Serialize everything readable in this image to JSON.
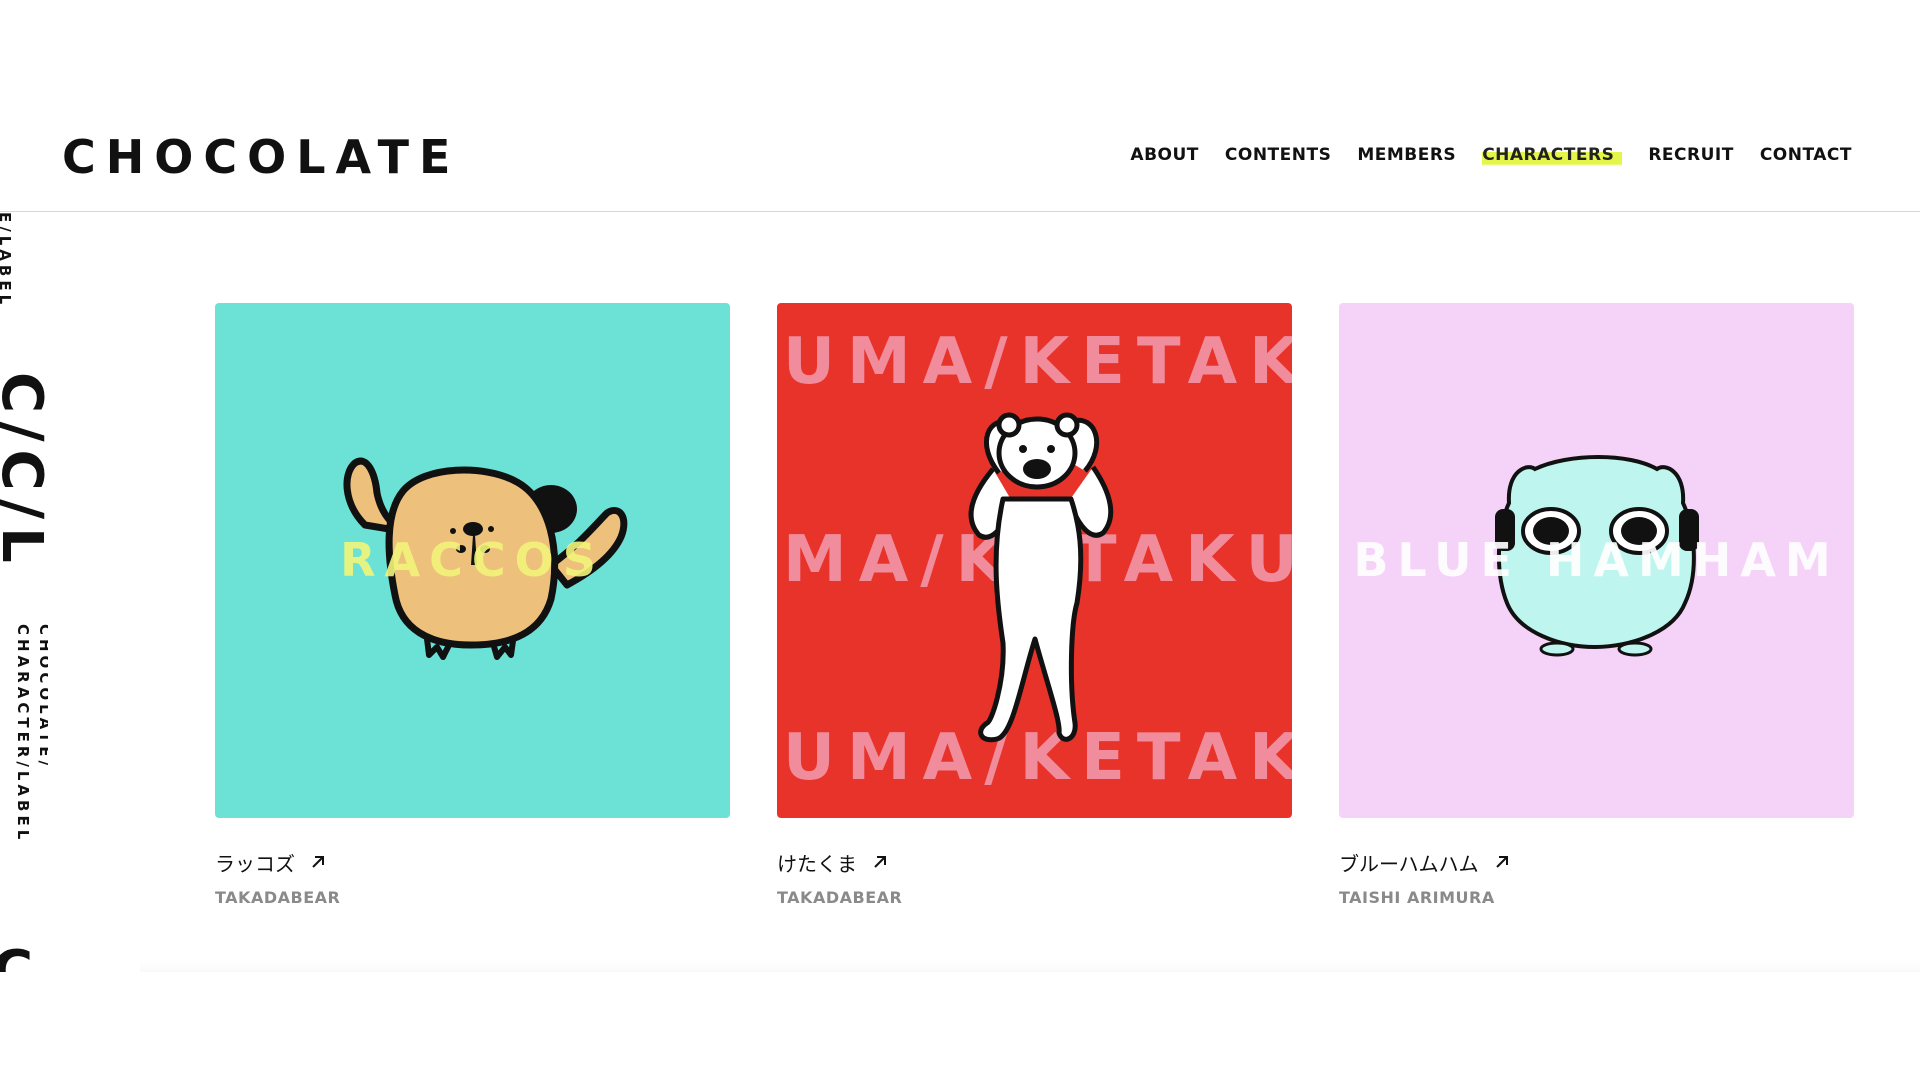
{
  "brand": {
    "logo": "CHOCOLATE"
  },
  "nav": {
    "items": [
      {
        "label": "ABOUT"
      },
      {
        "label": "CONTENTS"
      },
      {
        "label": "MEMBERS"
      },
      {
        "label": "CHARACTERS",
        "active": true
      },
      {
        "label": "RECRUIT"
      },
      {
        "label": "CONTACT"
      }
    ],
    "highlight_color": "#e6f54a"
  },
  "side": {
    "small_top": "E/LABEL",
    "big": "C/C/L",
    "small_mid": "CHOCOLATE/ CHARACTER/LABEL",
    "bottom_c": "C"
  },
  "cards": [
    {
      "title": "ラッコズ",
      "author": "TAKADABEAR",
      "overlay": "RACCOS",
      "bg_color": "#6be2d5",
      "overlay_color": "#f2f57a"
    },
    {
      "title": "けたくま",
      "author": "TAKADABEAR",
      "rows": [
        "UMA/KETAK",
        "MA/KETAKU",
        "UMA/KETAK"
      ],
      "bg_color": "#e8332a",
      "overlay_color": "#f08c9b"
    },
    {
      "title": "ブルーハムハム",
      "author": "TAISHI ARIMURA",
      "overlay": "BLUE HAMHAM",
      "bg_color": "#f5d3f8",
      "overlay_color": "#ffffff"
    }
  ],
  "icons": {
    "external": "arrow-up-right-icon"
  }
}
